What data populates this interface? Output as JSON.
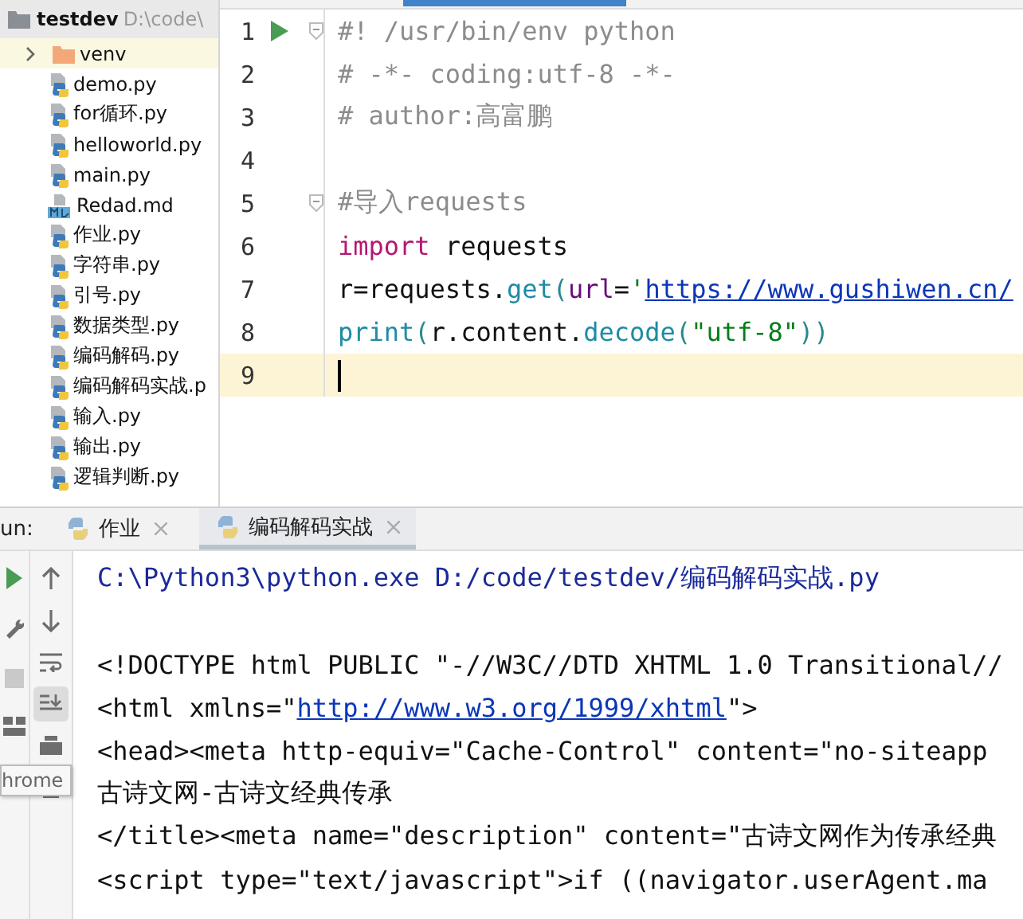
{
  "project": {
    "root": "testdev",
    "root_path": "D:\\code\\",
    "items": [
      {
        "name": "venv",
        "kind": "folder",
        "expanded": false,
        "selected": true
      },
      {
        "name": "demo.py",
        "kind": "python",
        "selected": false
      },
      {
        "name": "for循环.py",
        "kind": "python",
        "selected": false
      },
      {
        "name": "helloworld.py",
        "kind": "python",
        "selected": false
      },
      {
        "name": "main.py",
        "kind": "python",
        "selected": false
      },
      {
        "name": "Redad.md",
        "kind": "markdown",
        "selected": false
      },
      {
        "name": "作业.py",
        "kind": "python",
        "selected": false
      },
      {
        "name": "字符串.py",
        "kind": "python",
        "selected": false
      },
      {
        "name": "引号.py",
        "kind": "python",
        "selected": false
      },
      {
        "name": "数据类型.py",
        "kind": "python",
        "selected": false
      },
      {
        "name": "编码解码.py",
        "kind": "python",
        "selected": false
      },
      {
        "name": "编码解码实战.p",
        "kind": "python",
        "selected": false
      },
      {
        "name": "输入.py",
        "kind": "python",
        "selected": false
      },
      {
        "name": "输出.py",
        "kind": "python",
        "selected": false
      },
      {
        "name": "逻辑判断.py",
        "kind": "python",
        "selected": false
      }
    ]
  },
  "editor": {
    "lines": [
      {
        "number": "1",
        "runnable": true,
        "fold": true,
        "current": false,
        "segments": [
          {
            "kind": "comment",
            "text": "#! /usr/bin/env python"
          }
        ]
      },
      {
        "number": "2",
        "runnable": false,
        "fold": false,
        "current": false,
        "segments": [
          {
            "kind": "comment",
            "text": "# -*- coding:utf-8 -*-"
          }
        ]
      },
      {
        "number": "3",
        "runnable": false,
        "fold": false,
        "current": false,
        "segments": [
          {
            "kind": "comment",
            "text": "# author:高富鹏"
          }
        ]
      },
      {
        "number": "4",
        "runnable": false,
        "fold": false,
        "current": false
      },
      {
        "number": "5",
        "runnable": false,
        "fold": true,
        "current": false,
        "segments": [
          {
            "kind": "comment",
            "text": "#导入requests"
          }
        ]
      },
      {
        "number": "6",
        "runnable": false,
        "fold": false,
        "current": false,
        "segments": [
          {
            "kind": "keyword",
            "text": "import"
          },
          {
            "kind": "plain",
            "text": " requests"
          }
        ]
      },
      {
        "number": "7",
        "runnable": false,
        "fold": false,
        "current": false,
        "segments": [
          {
            "kind": "plain",
            "text": "r=requests."
          },
          {
            "kind": "func",
            "text": "get"
          },
          {
            "kind": "paren",
            "text": "("
          },
          {
            "kind": "param",
            "text": "url"
          },
          {
            "kind": "plain",
            "text": "="
          },
          {
            "kind": "string",
            "text": "'"
          },
          {
            "kind": "link",
            "text": "https://www.gushiwen.cn/"
          }
        ]
      },
      {
        "number": "8",
        "runnable": false,
        "fold": false,
        "current": false,
        "segments": [
          {
            "kind": "builtin",
            "text": "print"
          },
          {
            "kind": "paren",
            "text": "("
          },
          {
            "kind": "plain",
            "text": "r.content."
          },
          {
            "kind": "func",
            "text": "decode"
          },
          {
            "kind": "paren",
            "text": "("
          },
          {
            "kind": "string",
            "text": "\"utf-8\""
          },
          {
            "kind": "paren",
            "text": "))"
          }
        ]
      },
      {
        "number": "9",
        "runnable": false,
        "fold": false,
        "current": true
      }
    ]
  },
  "run": {
    "label": "un:",
    "tabs": [
      {
        "label": "作业",
        "selected": false
      },
      {
        "label": "编码解码实战",
        "selected": true
      }
    ],
    "console": [
      [
        {
          "kind": "command",
          "text": "C:\\Python3\\python.exe D:/code/testdev/编码解码实战.py"
        }
      ],
      [
        {
          "kind": "blank"
        }
      ],
      [
        {
          "kind": "plain",
          "text": "<!DOCTYPE html PUBLIC \"-//W3C//DTD XHTML 1.0 Transitional//"
        }
      ],
      [
        {
          "kind": "plain",
          "text": "<html xmlns=\""
        },
        {
          "kind": "link",
          "text": "http://www.w3.org/1999/xhtml"
        },
        {
          "kind": "plain",
          "text": "\">"
        }
      ],
      [
        {
          "kind": "plain",
          "text": "<head><meta http-equiv=\"Cache-Control\" content=\"no-siteapp"
        }
      ],
      [
        {
          "kind": "plain",
          "text": "古诗文网-古诗文经典传承"
        }
      ],
      [
        {
          "kind": "plain",
          "text": "</title><meta name=\"description\" content=\"古诗文网作为传承经典"
        }
      ],
      [
        {
          "kind": "plain",
          "text": "<script type=\"text/javascript\">if ((navigator.userAgent.ma"
        }
      ]
    ],
    "tooltip": "hrome"
  }
}
